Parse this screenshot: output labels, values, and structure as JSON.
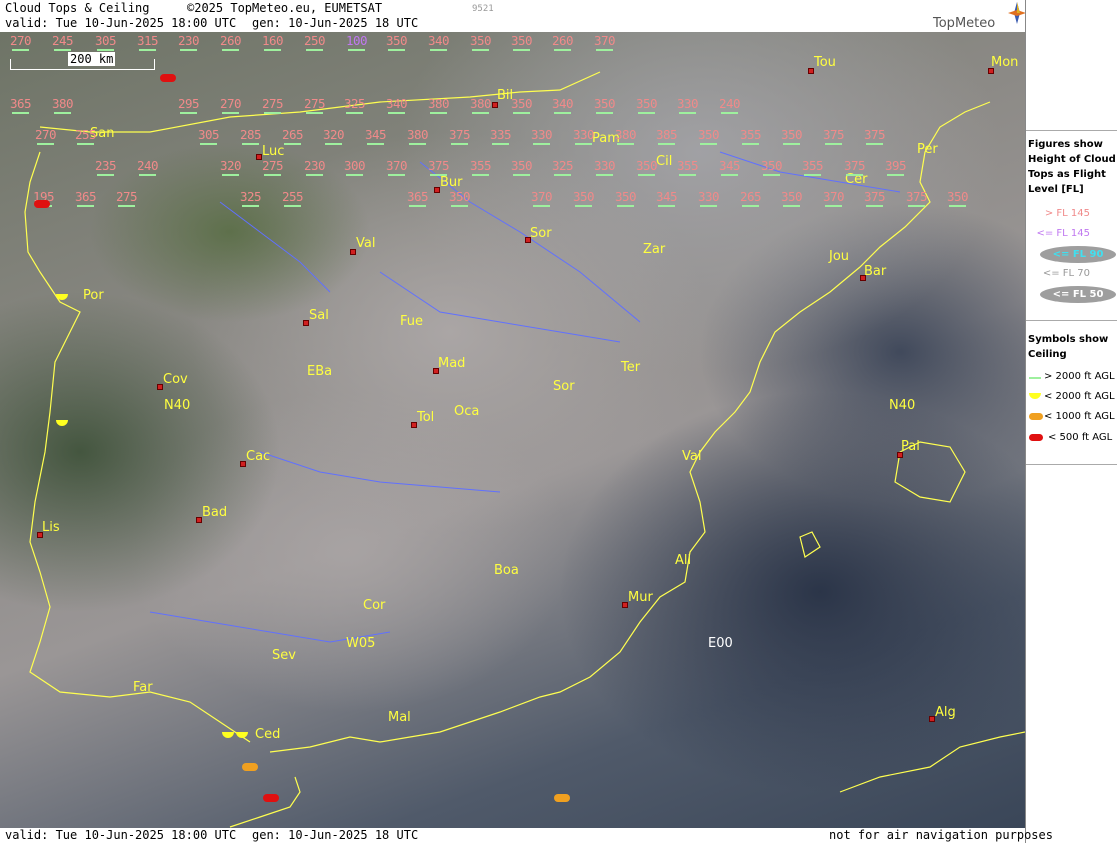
{
  "header": {
    "title": "Cloud Tops & Ceiling",
    "copyright": "©2025 TopMeteo.eu, EUMETSAT",
    "valid": "valid:  Tue  10-Jun-2025  18:00 UTC",
    "gen": "gen: 10-Jun-2025 18 UTC",
    "code": "9521",
    "logo": "TopMeteo"
  },
  "scale": {
    "label": "200 km"
  },
  "sidebar": {
    "figures_title": "Figures show Height of Cloud Tops as Flight Level  [FL]",
    "legend_levels": [
      {
        "label": "> FL 145",
        "color": "#f08a8a"
      },
      {
        "label": "<= FL 145",
        "color": "#c078f0"
      },
      {
        "label": "<= FL 90",
        "color": "#40e0f0"
      },
      {
        "label": "<= FL 70",
        "color": "#ffffff"
      },
      {
        "label": "<= FL 50",
        "color": "#ffffff"
      }
    ],
    "symbols_title": "Symbols show Ceiling",
    "symbols": [
      {
        "label": "> 2000 ft AGL",
        "icon": "green-line"
      },
      {
        "label": "< 2000 ft AGL",
        "icon": "yellow-half-circle"
      },
      {
        "label": "< 1000 ft AGL",
        "icon": "orange-pill"
      },
      {
        "label": "< 500 ft AGL",
        "icon": "red-pill"
      }
    ]
  },
  "footer": {
    "valid": "valid:  Tue  10-Jun-2025  18:00 UTC",
    "gen": "gen: 10-Jun-2025 18 UTC",
    "note": "not for air navigation purposes"
  },
  "cities": [
    "Tou",
    "Mon",
    "Bil",
    "San",
    "Pam",
    "Luc",
    "Cil",
    "Per",
    "Bur",
    "Cer",
    "Sor",
    "Val",
    "Zar",
    "Jou",
    "Bar",
    "Por",
    "Sal",
    "Fue",
    "Mad",
    "EBa",
    "Ter",
    "Cov",
    "Oca",
    "Sor",
    "Tol",
    "Pal",
    "Cac",
    "Val",
    "Bad",
    "Lis",
    "Ali",
    "Boa",
    "Mur",
    "Cor",
    "Sev",
    "Far",
    "Mal",
    "Ced",
    "Alg"
  ],
  "labels": [
    "N40",
    "N40",
    "E00",
    "W05"
  ],
  "flight_levels": [
    [
      "270",
      "245",
      "305",
      "315",
      "230",
      "260",
      "160",
      "250",
      "100",
      "350",
      "340",
      "350",
      "350",
      "260",
      "370"
    ],
    [
      "365",
      "380",
      "295",
      "270",
      "275",
      "275",
      "325",
      "340",
      "380",
      "380",
      "350",
      "340",
      "350",
      "350",
      "330",
      "240"
    ],
    [
      "270",
      "255",
      "305",
      "285",
      "265",
      "320",
      "345",
      "380",
      "375",
      "335",
      "330",
      "330",
      "380",
      "385",
      "350",
      "355",
      "350",
      "375",
      "375"
    ],
    [
      "235",
      "240",
      "320",
      "275",
      "230",
      "300",
      "370",
      "375",
      "355",
      "350",
      "325",
      "330",
      "350",
      "355",
      "345",
      "350",
      "355",
      "375",
      "395"
    ],
    [
      "195",
      "365",
      "275",
      "325",
      "255",
      "365",
      "350",
      "370",
      "350",
      "350",
      "345",
      "330",
      "265",
      "350",
      "370",
      "375",
      "375",
      "350"
    ]
  ]
}
